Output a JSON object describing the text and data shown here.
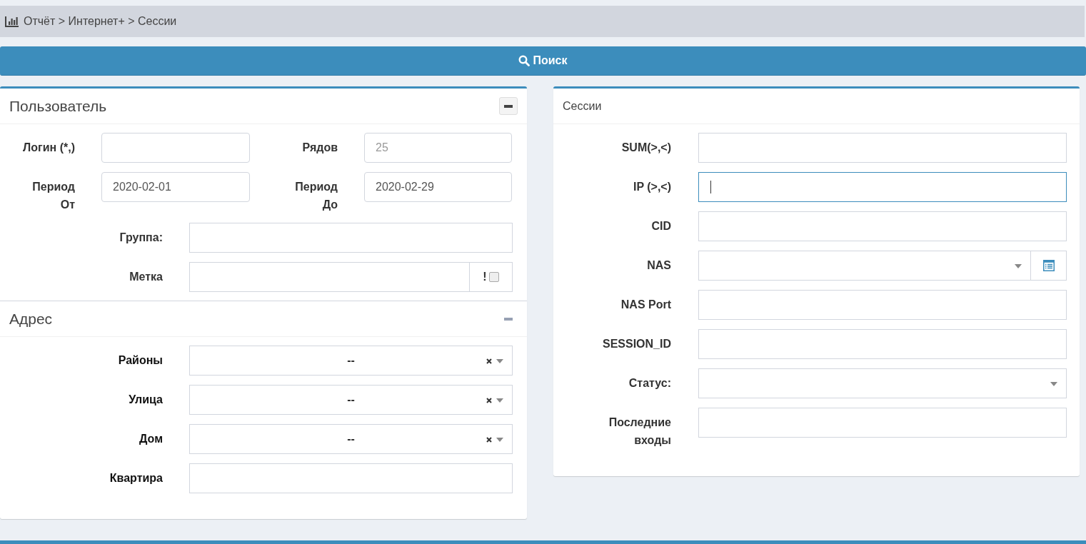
{
  "breadcrumb": {
    "text": "Отчёт > Интернет+ > Сессии"
  },
  "search_button": {
    "label": "Поиск"
  },
  "user_panel": {
    "title": "Пользователь",
    "pair_rows": [
      [
        {
          "label": "Логин (*,)"
        },
        {
          "label": "Рядов",
          "placeholder": "25"
        }
      ],
      [
        {
          "label": "Период От",
          "value": "2020-02-01"
        },
        {
          "label": "Период До",
          "value": "2020-02-29"
        }
      ]
    ],
    "fields": [
      {
        "label": "Группа:",
        "kind": "text"
      },
      {
        "label": "Метка",
        "kind": "flag_text",
        "flag": "!",
        "checked": false
      }
    ]
  },
  "address_panel": {
    "title": "Адрес",
    "fields": [
      {
        "label": "Районы",
        "kind": "select",
        "value": "--"
      },
      {
        "label": "Улица",
        "kind": "select",
        "value": "--"
      },
      {
        "label": "Дом",
        "kind": "select",
        "value": "--"
      },
      {
        "label": "Квартира",
        "kind": "text"
      }
    ]
  },
  "sessions_panel": {
    "title": "Сессии",
    "fields": [
      {
        "label": "SUM(>,<)",
        "kind": "text",
        "focused": false
      },
      {
        "label": "IP (>,<)",
        "kind": "text",
        "focused": true
      },
      {
        "label": "CID",
        "kind": "text",
        "focused": false
      },
      {
        "label": "NAS",
        "kind": "select_list",
        "focused": false
      },
      {
        "label": "NAS Port",
        "kind": "text",
        "focused": false
      },
      {
        "label": "SESSION_ID",
        "kind": "text",
        "focused": false
      },
      {
        "label": "Статус:",
        "kind": "select",
        "focused": false
      },
      {
        "label": "Последние входы",
        "kind": "text",
        "focused": false
      }
    ]
  }
}
